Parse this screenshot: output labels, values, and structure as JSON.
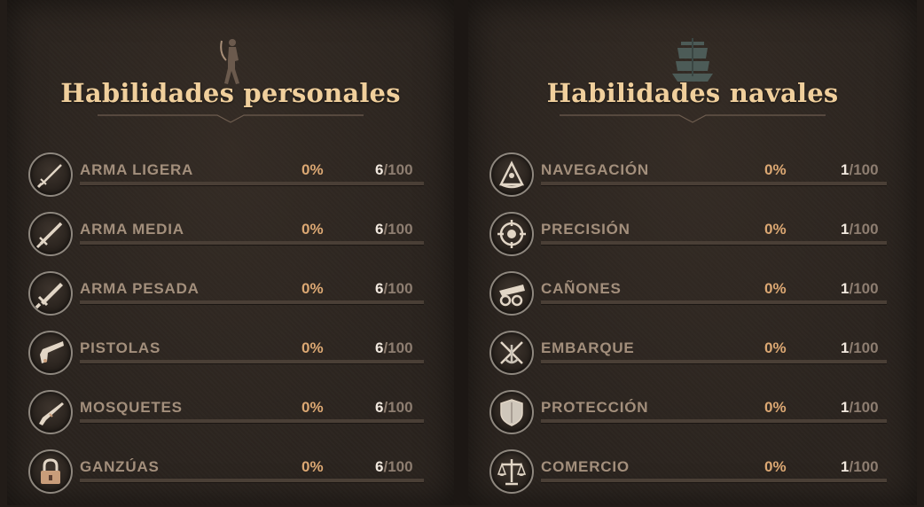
{
  "personal": {
    "title": "Habilidades personales",
    "header_icon": "swordsman-icon",
    "skills": [
      {
        "name": "ARMA LIGERA",
        "icon": "light-sword-icon",
        "percent": "0%",
        "level": "6",
        "max": "/100",
        "progress": 0
      },
      {
        "name": "ARMA MEDIA",
        "icon": "medium-sword-icon",
        "percent": "0%",
        "level": "6",
        "max": "/100",
        "progress": 0
      },
      {
        "name": "ARMA PESADA",
        "icon": "heavy-sword-icon",
        "percent": "0%",
        "level": "6",
        "max": "/100",
        "progress": 0
      },
      {
        "name": "PISTOLAS",
        "icon": "pistol-icon",
        "percent": "0%",
        "level": "6",
        "max": "/100",
        "progress": 0
      },
      {
        "name": "MOSQUETES",
        "icon": "musket-icon",
        "percent": "0%",
        "level": "6",
        "max": "/100",
        "progress": 0
      },
      {
        "name": "GANZÚAS",
        "icon": "lockpick-icon",
        "percent": "0%",
        "level": "6",
        "max": "/100",
        "progress": 0
      }
    ]
  },
  "naval": {
    "title": "Habilidades navales",
    "header_icon": "ship-icon",
    "skills": [
      {
        "name": "NAVEGACIÓN",
        "icon": "sextant-icon",
        "percent": "0%",
        "level": "1",
        "max": "/100",
        "progress": 0
      },
      {
        "name": "PRECISIÓN",
        "icon": "crosshair-icon",
        "percent": "0%",
        "level": "1",
        "max": "/100",
        "progress": 0
      },
      {
        "name": "CAÑONES",
        "icon": "cannon-icon",
        "percent": "0%",
        "level": "1",
        "max": "/100",
        "progress": 0
      },
      {
        "name": "EMBARQUE",
        "icon": "crossed-swords-anchor-icon",
        "percent": "0%",
        "level": "1",
        "max": "/100",
        "progress": 0
      },
      {
        "name": "PROTECCIÓN",
        "icon": "shield-icon",
        "percent": "0%",
        "level": "1",
        "max": "/100",
        "progress": 0
      },
      {
        "name": "COMERCIO",
        "icon": "scales-icon",
        "percent": "0%",
        "level": "1",
        "max": "/100",
        "progress": 0
      }
    ]
  },
  "colors": {
    "title": "#f0cf9c",
    "label": "#a38f7c",
    "percent": "#dca873",
    "level_current": "#f1e8de",
    "bar_track": "#4a3f36",
    "panel_bg": "#2b241f"
  }
}
